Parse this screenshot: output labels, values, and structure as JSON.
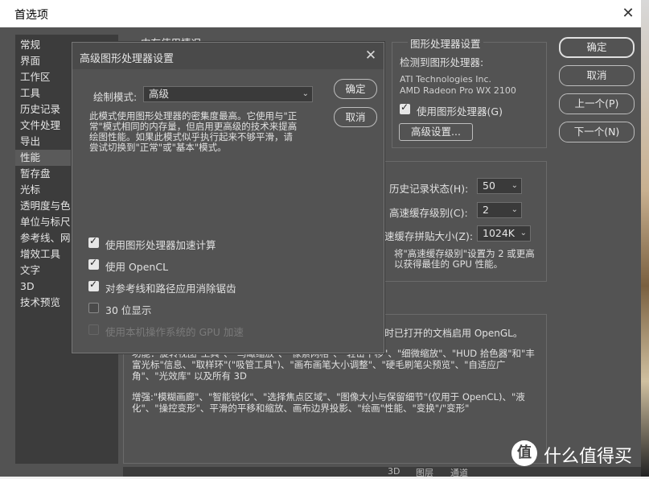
{
  "prefs": {
    "title": "首选项",
    "sidebar": [
      "常规",
      "界面",
      "工作区",
      "工具",
      "历史记录",
      "文件处理",
      "导出",
      "性能",
      "暂存盘",
      "光标",
      "透明度与色域",
      "单位与标尺",
      "参考线、网格",
      "增效工具",
      "文字",
      "3D",
      "技术预览"
    ],
    "selected_index": 7,
    "memory_group_title": "内存使用情况",
    "gpu": {
      "group_title": "图形处理器设置",
      "detected_label": "检测到图形处理器:",
      "vendor": "ATI Technologies Inc.",
      "model": "AMD Radeon Pro WX 2100",
      "use_gpu_label": "使用图形处理器(G)",
      "advanced_button": "高级设置..."
    },
    "buttons": {
      "ok": "确定",
      "cancel": "取消",
      "prev": "上一个(P)",
      "next": "下一个(N)"
    },
    "history": {
      "history_label": "历史记录状态(H):",
      "history_value": "50",
      "cache_level_label": "高速缓存级别(C):",
      "cache_level_value": "2",
      "tile_size_label": "速缓存拼贴大小(Z):",
      "tile_size_value": "1024K",
      "note": "将\"高速缓存级别\"设置为 2 或更高以获得最佳的 GPU 性能。"
    },
    "description": {
      "line_opengl": "时已打开的文档启用 OpenGL。",
      "features": "功能：旋转视图\"工具\"、\"鸟瞰缩放\"、\"像素网格\"、\"轻击平移\"、\"细微缩放\"、\"HUD 拾色器\"和\"丰富光标\"信息、\"取样环\"(\"吸管工具\")、\"画布画笔大小调整\"、\"硬毛刷笔尖预览\"、\"自适应广角\"、\"光效库\" 以及所有 3D",
      "enhanced": "增强:\"模糊画廊\"、\"智能锐化\"、\"选择焦点区域\"、\"图像大小与保留细节\"(仅用于 OpenCL)、\"液化\"、\"操控变形\"、平滑的平移和缩放、画布边界投影、\"绘画\"性能、\"变换\"/\"变形\""
    },
    "bottom_tabs": [
      "3D",
      "图层",
      "通道"
    ]
  },
  "advanced": {
    "title": "高级图形处理器设置",
    "mode_label": "绘制模式:",
    "mode_value": "高级",
    "ok": "确定",
    "cancel": "取消",
    "description": "此模式使用图形处理器的密集度最高。它使用与\"正常\"模式相同的内存量，但启用更高级的技术来提高绘图性能。如果此模式似乎执行起来不够平滑，请尝试切换到\"正常\"或\"基本\"模式。",
    "options": [
      {
        "label": "使用图形处理器加速计算",
        "checked": true,
        "disabled": false
      },
      {
        "label": "使用 OpenCL",
        "checked": true,
        "disabled": false
      },
      {
        "label": "对参考线和路径应用消除锯齿",
        "checked": true,
        "disabled": false
      },
      {
        "label": "30 位显示",
        "checked": false,
        "disabled": false
      },
      {
        "label": "使用本机操作系统的 GPU 加速",
        "checked": false,
        "disabled": true
      }
    ]
  },
  "watermark": {
    "logo": "值",
    "text": "什么值得买"
  }
}
